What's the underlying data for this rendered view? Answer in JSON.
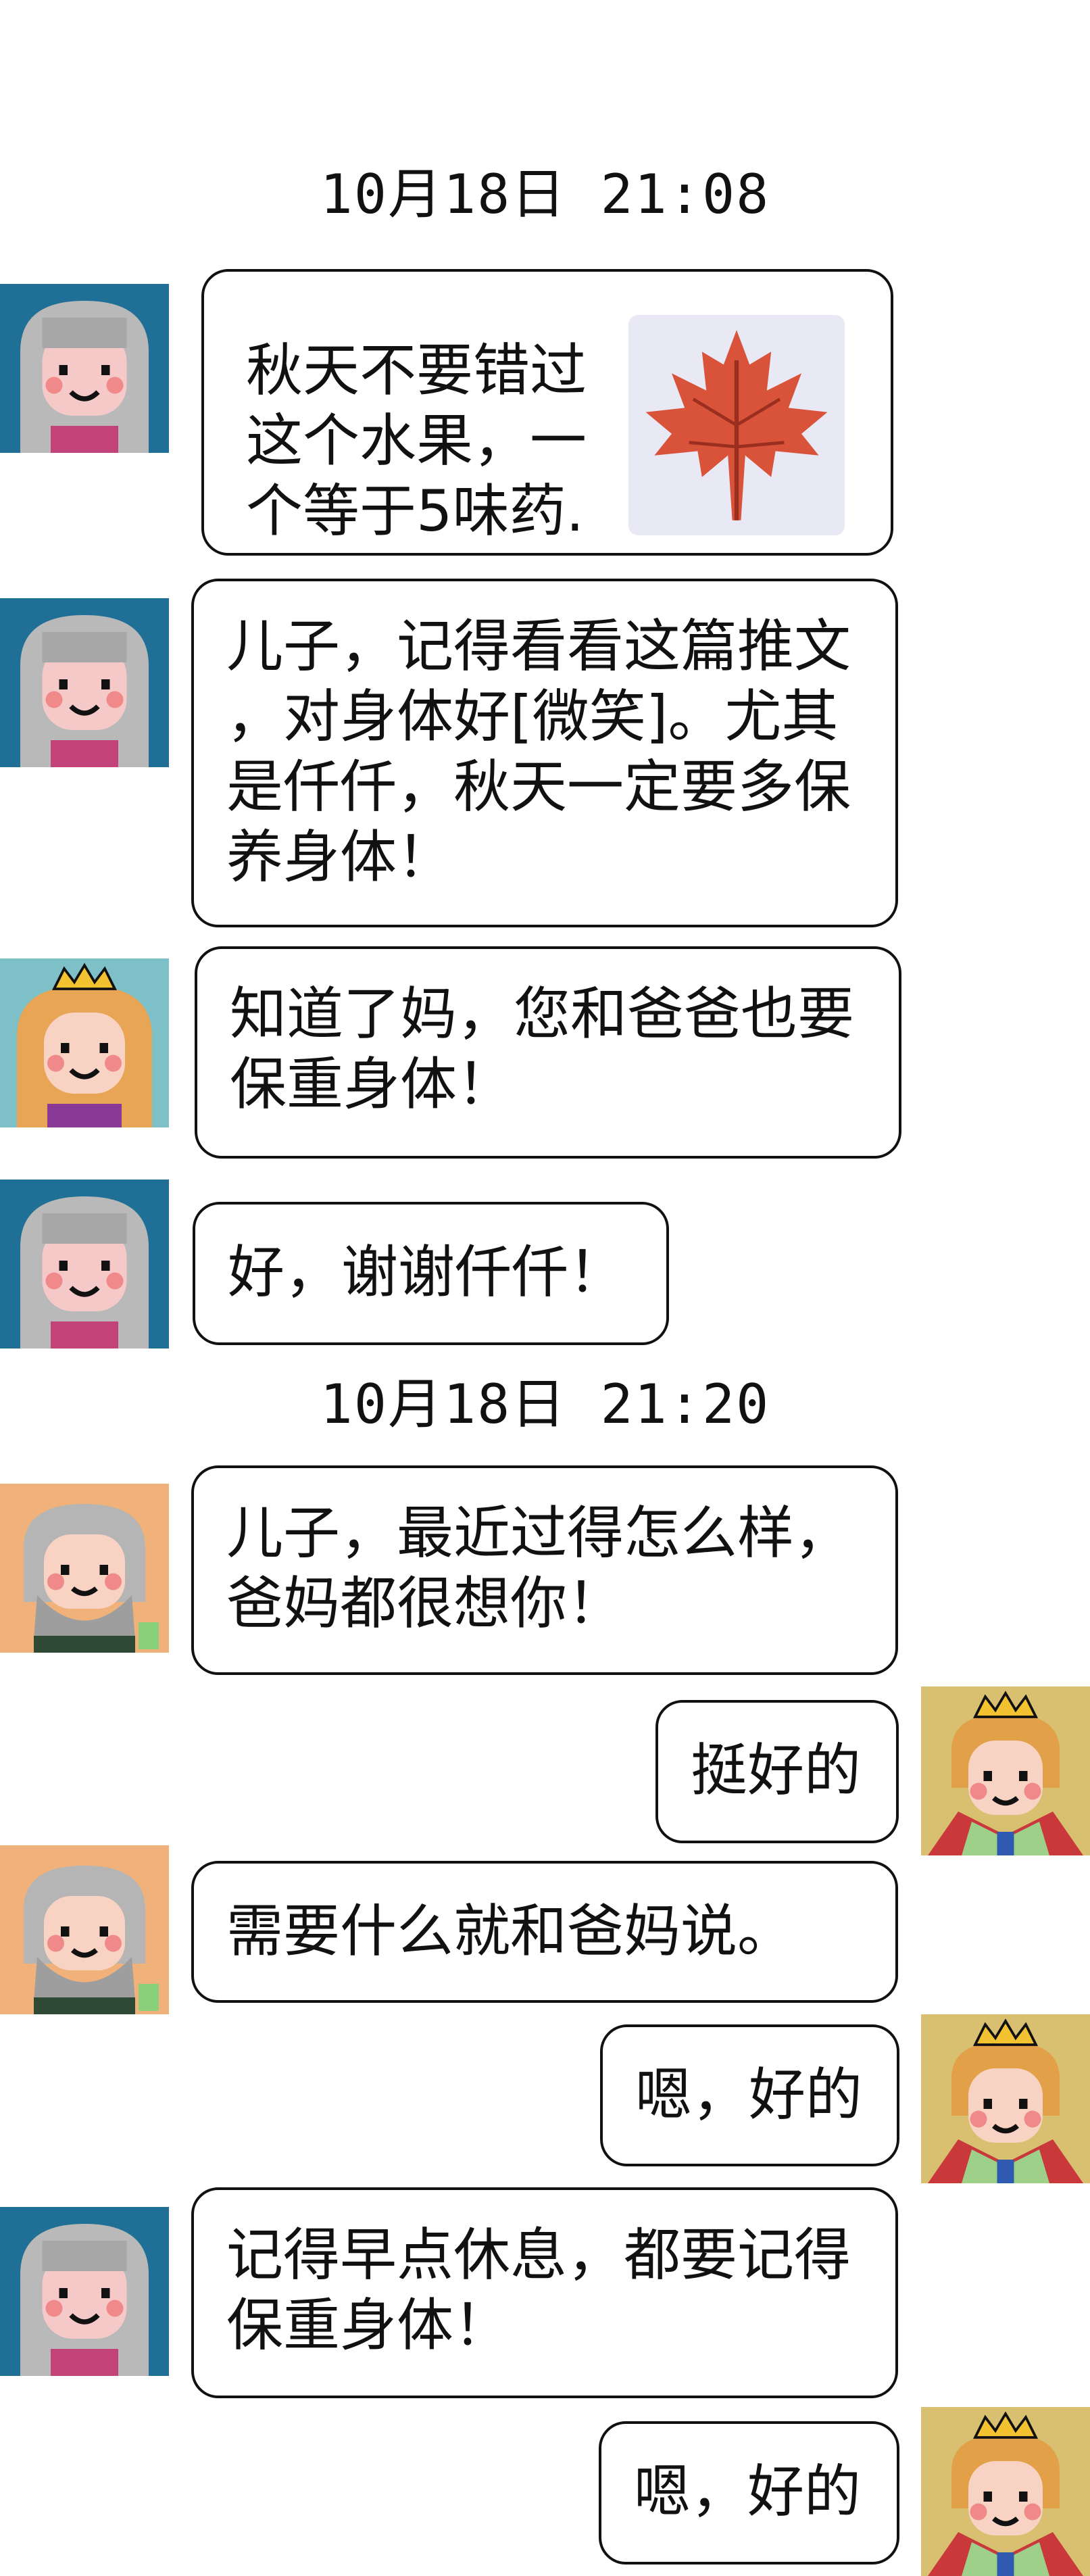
{
  "timestamps": [
    "10月18日 21:08",
    "10月18日 21:20"
  ],
  "messages": [
    {
      "sender": "mom",
      "text": "秋天不要错过\n这个水果，一\n个等于5味药.",
      "has_thumbnail": true,
      "thumbnail_icon": "maple-leaf-icon"
    },
    {
      "sender": "mom",
      "text": "儿子，记得看看这篇推文\n，对身体好[微笑]。尤其\n是仟仟，秋天一定要多保\n养身体！"
    },
    {
      "sender": "qianqian",
      "text": "知道了妈，您和爸爸也要\n保重身体！"
    },
    {
      "sender": "mom",
      "text": "好，谢谢仟仟！"
    },
    {
      "sender": "dad",
      "text": "儿子，最近过得怎么样，\n爸妈都很想你！"
    },
    {
      "sender": "son",
      "text": "挺好的"
    },
    {
      "sender": "dad",
      "text": "需要什么就和爸妈说。"
    },
    {
      "sender": "son",
      "text": "嗯，好的"
    },
    {
      "sender": "mom",
      "text": "记得早点休息，都要记得\n保重身体！"
    },
    {
      "sender": "son",
      "text": "嗯，好的"
    }
  ],
  "colors": {
    "mom_bg": "#1f6f96",
    "qianqian_bg": "#7ec0c8",
    "dad_bg": "#f0b27a",
    "son_bg": "#d8c070",
    "border": "#111111",
    "leaf": "#d9533a"
  }
}
